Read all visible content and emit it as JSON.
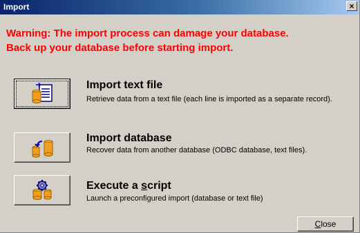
{
  "window": {
    "title": "Import",
    "close_glyph": "×"
  },
  "warning": {
    "line1": "Warning: The import process can damage your database.",
    "line2": "Back up your database before starting import.",
    "color": "#ff0000"
  },
  "options": [
    {
      "title": "Import text file",
      "description": "Retrieve data from a text file (each line is imported as a separate record).",
      "icon": "import-text-file-icon"
    },
    {
      "title": "Import database",
      "description": "Recover data from another database (ODBC database, text files).",
      "icon": "import-database-icon"
    },
    {
      "title_before": "Execute a ",
      "title_underlined": "s",
      "title_after": "cript",
      "description": "Launch a preconfigured import (database or text file)",
      "icon": "execute-script-icon"
    }
  ],
  "footer": {
    "close_underlined": "C",
    "close_rest": "lose"
  },
  "colors": {
    "titlebar_start": "#0a246a",
    "titlebar_end": "#a6caf0",
    "face": "#d4d0c8"
  }
}
